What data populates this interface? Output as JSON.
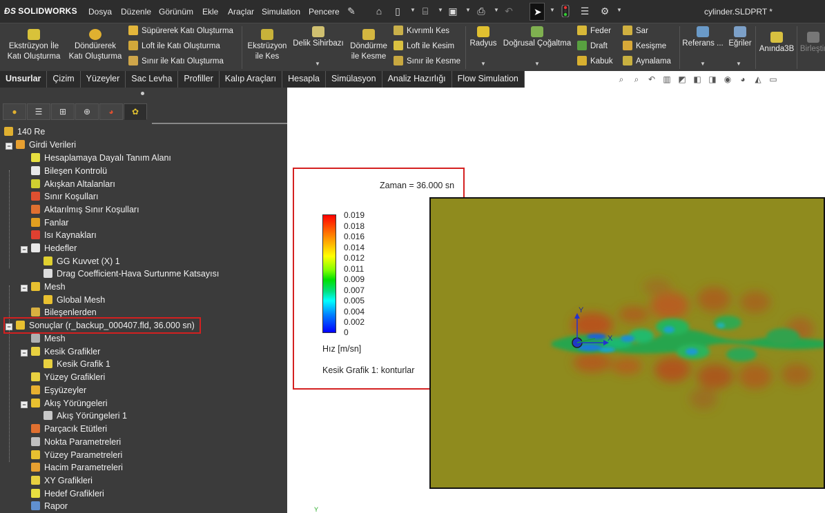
{
  "app": {
    "logo": "SOLIDWORKS",
    "menu": [
      "Dosya",
      "Düzenle",
      "Görünüm",
      "Ekle",
      "Araçlar",
      "Simulation",
      "Pencere"
    ],
    "document_title": "cylinder.SLDPRT *"
  },
  "ribbon": {
    "extrude_boss": "Ekstrüzyon İle\nKatı Oluşturma",
    "revolve_boss": "Döndürerek\nKatı Oluşturma",
    "sweep_boss": "Süpürerek Katı Oluşturma",
    "loft_boss": "Loft ile Katı Oluşturma",
    "boundary_boss": "Sınır ile Katı Oluşturma",
    "extrude_cut": "Ekstrüzyon\nile Kes",
    "hole_wizard": "Delik Sihirbazı",
    "revolve_cut": "Döndürme\nile Kesme",
    "swept_cut": "Kıvrımlı Kes",
    "loft_cut": "Loft ile Kesim",
    "boundary_cut": "Sınır ile Kesme",
    "fillet": "Radyus",
    "linear_pattern": "Doğrusal Çoğaltma",
    "rib": "Feder",
    "draft": "Draft",
    "shell": "Kabuk",
    "wrap": "Sar",
    "intersect": "Kesişme",
    "mirror": "Aynalama",
    "reference": "Referans ...",
    "curves": "Eğriler",
    "instant3d": "Anında3B",
    "combine": "Birleştir"
  },
  "tabs": [
    "Unsurlar",
    "Çizim",
    "Yüzeyler",
    "Sac Levha",
    "Profiller",
    "Kalıp Araçları",
    "Hesapla",
    "Simülasyon",
    "Analiz Hazırlığı",
    "Flow Simulation"
  ],
  "tree": {
    "root": "140 Re",
    "input_data": "Girdi Verileri",
    "computational_domain": "Hesaplamaya Dayalı Tanım Alanı",
    "component_control": "Bileşen Kontrolü",
    "fluid_subdomains": "Akışkan Altalanları",
    "boundary_conditions": "Sınır Koşulları",
    "transferred_bc": "Aktarılmış Sınır Koşulları",
    "fans": "Fanlar",
    "heat_sources": "Isı Kaynakları",
    "goals": "Hedefler",
    "goal_force": "GG Kuvvet (X) 1",
    "goal_drag": "Drag Coefficient-Hava Surtunme Katsayısı",
    "mesh": "Mesh",
    "global_mesh": "Global Mesh",
    "components": "Bileşenlerden",
    "results": "Sonuçlar (r_backup_000407.fld, 36.000 sn)",
    "results_mesh": "Mesh",
    "cut_plots": "Kesik Grafikler",
    "cut_plot_1": "Kesik Grafik 1",
    "surface_plots": "Yüzey Grafikleri",
    "isosurfaces": "Eşyüzeyler",
    "flow_trajectories": "Akış Yörüngeleri",
    "flow_trajectories_1": "Akış Yörüngeleri 1",
    "particle_studies": "Parçacık Etütleri",
    "point_parameters": "Nokta Parametreleri",
    "surface_parameters": "Yüzey Parametreleri",
    "volume_parameters": "Hacim Parametreleri",
    "xy_plots": "XY Grafikleri",
    "goal_plots": "Hedef Grafikleri",
    "report": "Rapor"
  },
  "legend": {
    "time": "Zaman = 36.000 sn",
    "ticks": [
      "0.019",
      "0.018",
      "0.016",
      "0.014",
      "0.012",
      "0.011",
      "0.009",
      "0.007",
      "0.005",
      "0.004",
      "0.002",
      "0"
    ],
    "unit": "Hız [m/sn]",
    "plot_name": "Kesik Grafik 1: konturlar"
  },
  "axes": {
    "x": "X",
    "y": "Y",
    "small_y": "Y"
  },
  "colors": {
    "background_field": "#8f8b1e",
    "highlight": "#d42020",
    "panel": "#3b3b3b"
  }
}
